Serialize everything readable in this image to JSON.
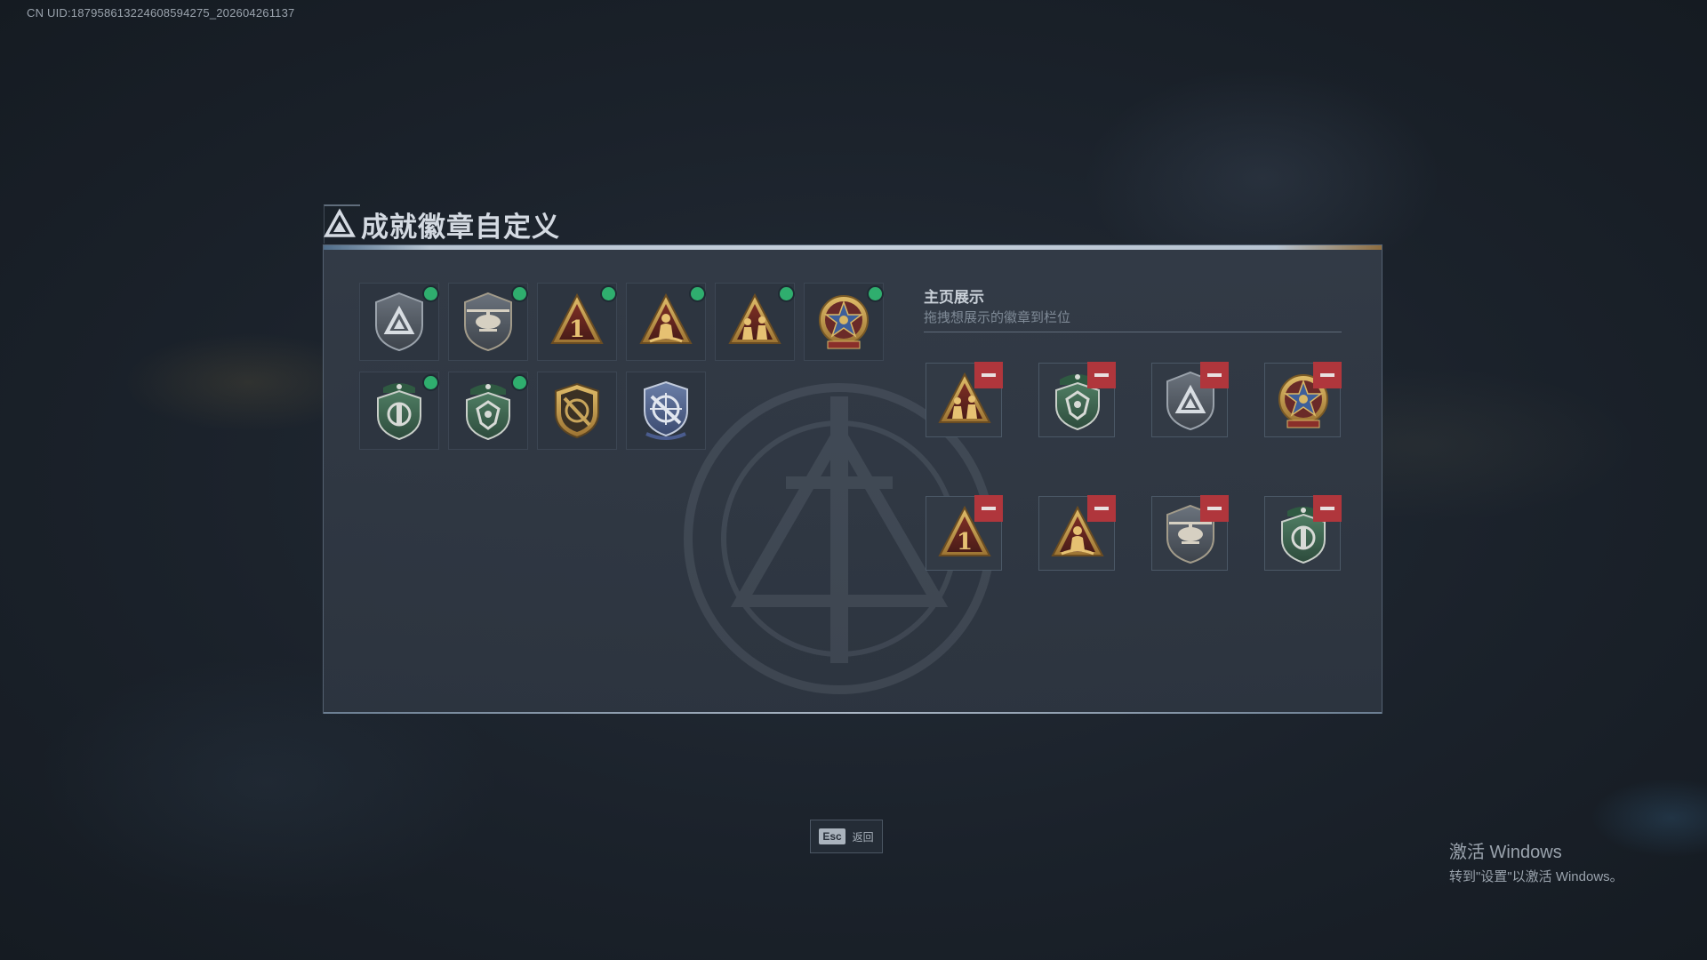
{
  "header": {
    "uid_text": "CN UID:187958613224608594275_202604261137",
    "title": "成就徽章自定义"
  },
  "owned_badges": [
    {
      "icon": "shield-triangle-badge",
      "new": true
    },
    {
      "icon": "helicopter-badge",
      "new": true
    },
    {
      "icon": "number-one-triangle-badge",
      "new": true
    },
    {
      "icon": "soldier-triangle-badge",
      "new": true
    },
    {
      "icon": "squad-triangle-badge",
      "new": true
    },
    {
      "icon": "star-medal-badge",
      "new": true
    },
    {
      "icon": "green-crest-badge",
      "new": true
    },
    {
      "icon": "green-beret-badge",
      "new": true
    },
    {
      "icon": "crossed-sword-shield-badge",
      "new": false
    },
    {
      "icon": "blue-crosshair-badge",
      "new": false
    }
  ],
  "showcase": {
    "title": "主页展示",
    "subtitle": "拖拽想展示的徽章到栏位",
    "slots": [
      {
        "icon": "squad-triangle-badge"
      },
      {
        "icon": "green-beret-badge"
      },
      {
        "icon": "shield-triangle-badge"
      },
      {
        "icon": "star-medal-badge"
      },
      {
        "icon": "number-one-triangle-badge"
      },
      {
        "icon": "soldier-triangle-badge"
      },
      {
        "icon": "helicopter-badge"
      },
      {
        "icon": "green-crest-badge"
      }
    ]
  },
  "footer": {
    "esc_key": "Esc",
    "esc_label": "返回"
  },
  "windows_watermark": {
    "line1": "激活 Windows",
    "line2": "转到\"设置\"以激活 Windows。"
  },
  "colors": {
    "new_dot": "#2fae6e",
    "remove_button": "#b0363c",
    "gold": "#c8a050",
    "dark_red": "#6e2a22",
    "green": "#3f6b52"
  }
}
